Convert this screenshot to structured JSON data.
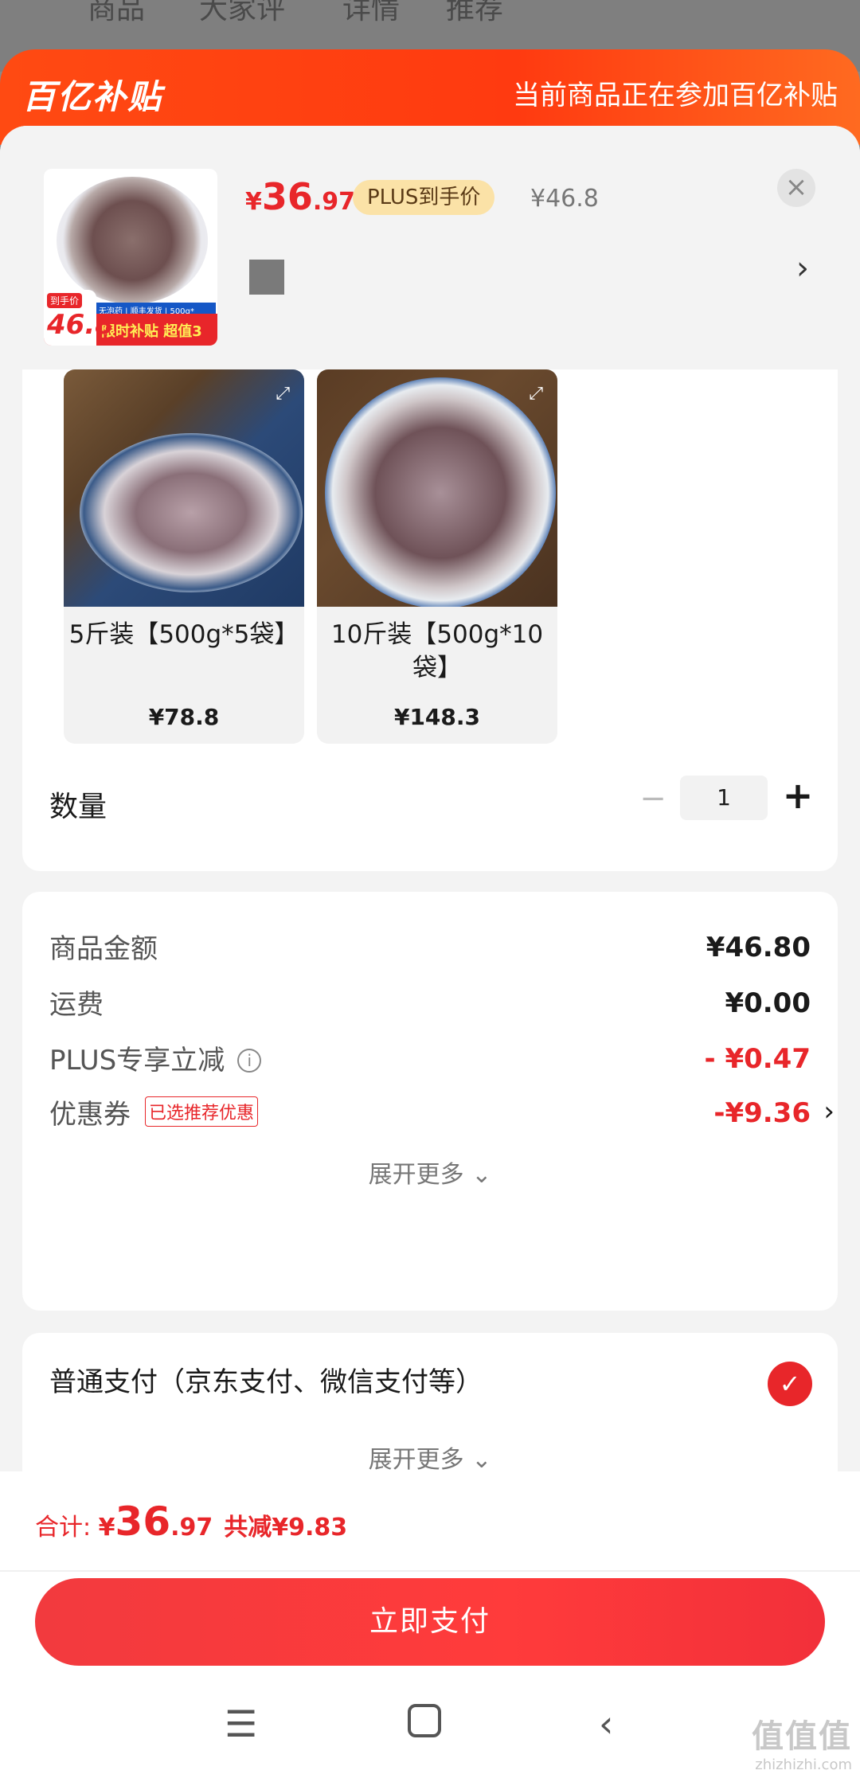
{
  "background": {
    "tabs": [
      "商品",
      "大家评",
      "详情",
      "推荐"
    ]
  },
  "banner": {
    "logo": "百亿补贴",
    "text": "当前商品正在参加百亿补贴"
  },
  "product": {
    "price_yen": "¥",
    "price_int": "36",
    "price_dec": ".97",
    "plus_tag": "PLUS到手价",
    "original_price": "¥46.8",
    "thumb_tag_label": "到手价",
    "thumb_tag_price": "46.8",
    "thumb_strip": "无泡药 | 顺丰发货 | 500g*",
    "thumb_strip2": "限时补贴 超值3"
  },
  "variants": [
    {
      "name": "5斤装【500g*5袋】",
      "price": "¥78.8"
    },
    {
      "name": "10斤装【500g*10袋】",
      "price": "¥148.3"
    }
  ],
  "quantity": {
    "label": "数量",
    "value": "1",
    "minus": "−",
    "plus": "+"
  },
  "fees": {
    "goods_amount": {
      "label": "商品金额",
      "value": "¥46.80"
    },
    "shipping": {
      "label": "运费",
      "value": "¥0.00"
    },
    "plus_discount": {
      "label": "PLUS专享立减",
      "value": "- ¥0.47"
    },
    "coupon": {
      "label": "优惠券",
      "badge": "已选推荐优惠",
      "value": "-¥9.36"
    },
    "expand": "展开更多 ⌄"
  },
  "payment": {
    "label": "普通支付（京东支付、微信支付等）",
    "expand": "展开更多 ⌄"
  },
  "total": {
    "label": "合计: ",
    "yen": "¥",
    "int": "36",
    "dec": ".97",
    "saved": "共减¥9.83"
  },
  "pay_button": "立即支付",
  "watermark": {
    "main": "值值值",
    "sub": "zhizhizhi.com"
  },
  "colors": {
    "accent": "#e8262a",
    "banner": "#ff4a12",
    "plus_tag": "#fbe2a7"
  }
}
